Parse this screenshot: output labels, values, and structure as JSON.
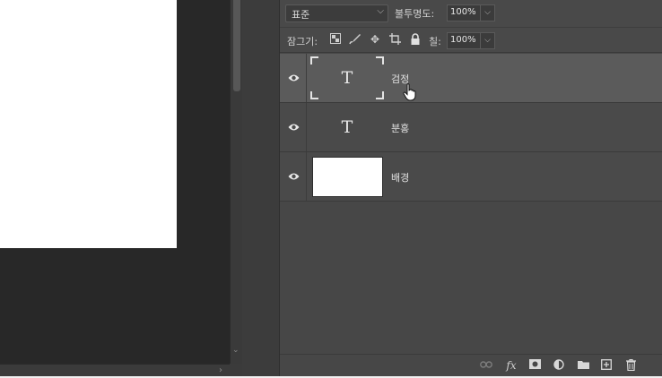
{
  "layers_panel": {
    "blend_mode": "표준",
    "opacity_label": "불투명도:",
    "opacity_value": "100%",
    "lock_label": "잠그기:",
    "fill_label": "칠:",
    "fill_value": "100%",
    "layers": [
      {
        "name": "검정",
        "kind": "text",
        "thumb_glyph": "T",
        "selected": true,
        "visible": true
      },
      {
        "name": "분홍",
        "kind": "text",
        "thumb_glyph": "T",
        "selected": false,
        "visible": true
      },
      {
        "name": "배경",
        "kind": "background",
        "selected": false,
        "visible": true
      }
    ],
    "lock_icons": [
      "lock-transparent-pixels-icon",
      "lock-image-pixels-icon",
      "lock-position-icon",
      "lock-artboard-icon",
      "lock-all-icon"
    ],
    "footer_icons": [
      "link-layers-icon",
      "fx-icon",
      "add-mask-icon",
      "adjustment-layer-icon",
      "new-group-icon",
      "new-layer-icon",
      "delete-layer-icon"
    ]
  },
  "colors": {
    "panel_bg": "#474747",
    "selected_row": "#5b5b5b",
    "canvas_bg": "#282828",
    "document": "#ffffff"
  }
}
